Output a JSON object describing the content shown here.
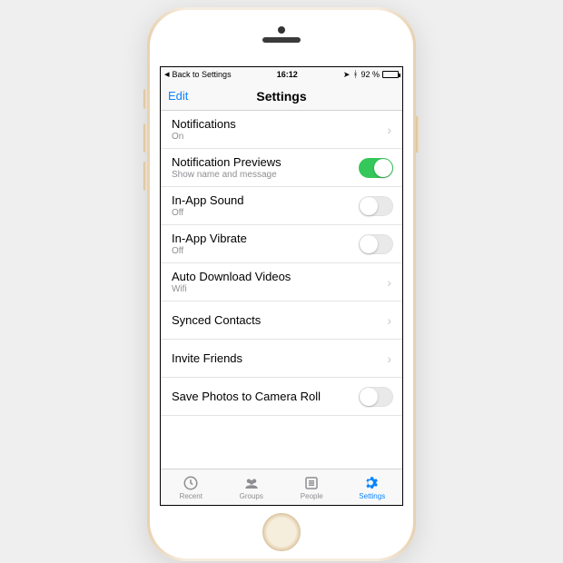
{
  "status": {
    "back": "Back to Settings",
    "time": "16:12",
    "battery_pct": "92 %"
  },
  "navbar": {
    "edit": "Edit",
    "title": "Settings"
  },
  "rows": [
    {
      "label": "Notifications",
      "sub": "On"
    },
    {
      "label": "Notification Previews",
      "sub": "Show name and message"
    },
    {
      "label": "In-App Sound",
      "sub": "Off"
    },
    {
      "label": "In-App Vibrate",
      "sub": "Off"
    },
    {
      "label": "Auto Download Videos",
      "sub": "Wifi"
    },
    {
      "label": "Synced Contacts",
      "sub": ""
    },
    {
      "label": "Invite Friends",
      "sub": ""
    },
    {
      "label": "Save Photos to Camera Roll",
      "sub": ""
    }
  ],
  "tabs": {
    "recent": "Recent",
    "groups": "Groups",
    "people": "People",
    "settings": "Settings"
  }
}
